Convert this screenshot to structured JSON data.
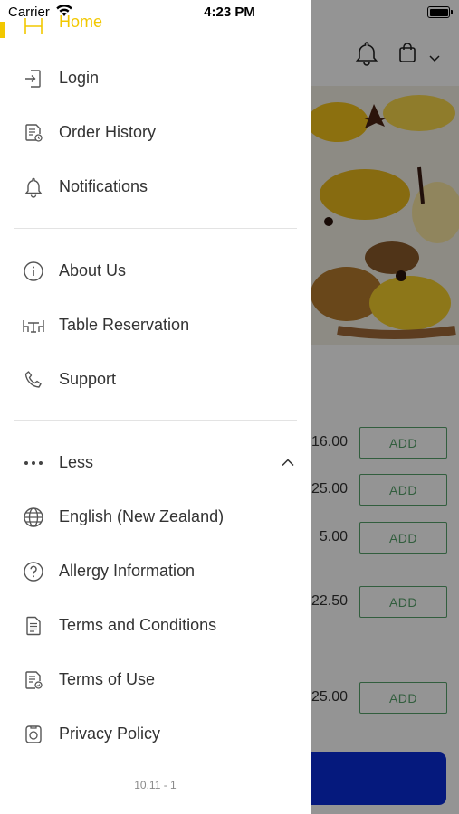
{
  "status_bar": {
    "carrier": "Carrier",
    "time": "4:23 PM"
  },
  "drawer": {
    "home": {
      "label": "Home"
    },
    "items_group1": [
      {
        "label": "Login",
        "icon": "login-icon"
      },
      {
        "label": "Order History",
        "icon": "order-history-icon"
      },
      {
        "label": "Notifications",
        "icon": "bell-icon"
      }
    ],
    "items_group2": [
      {
        "label": "About Us",
        "icon": "info-icon"
      },
      {
        "label": "Table Reservation",
        "icon": "table-icon"
      },
      {
        "label": "Support",
        "icon": "phone-icon"
      }
    ],
    "less": {
      "label": "Less",
      "icon": "more-dots-icon"
    },
    "items_group3": [
      {
        "label": "English (New Zealand)",
        "icon": "globe-icon"
      },
      {
        "label": "Allergy Information",
        "icon": "question-icon"
      },
      {
        "label": "Terms and Conditions",
        "icon": "document-icon"
      },
      {
        "label": "Terms of Use",
        "icon": "document-check-icon"
      },
      {
        "label": "Privacy Policy",
        "icon": "privacy-icon"
      }
    ],
    "version": "10.11 - 1"
  },
  "background": {
    "prices": [
      "16.00",
      "25.00",
      "5.00",
      "22.50",
      "25.00"
    ],
    "add_label": "ADD"
  },
  "colors": {
    "accent": "#f2c800",
    "add_green": "#57a36b",
    "primary_blue": "#0a2bd8"
  }
}
